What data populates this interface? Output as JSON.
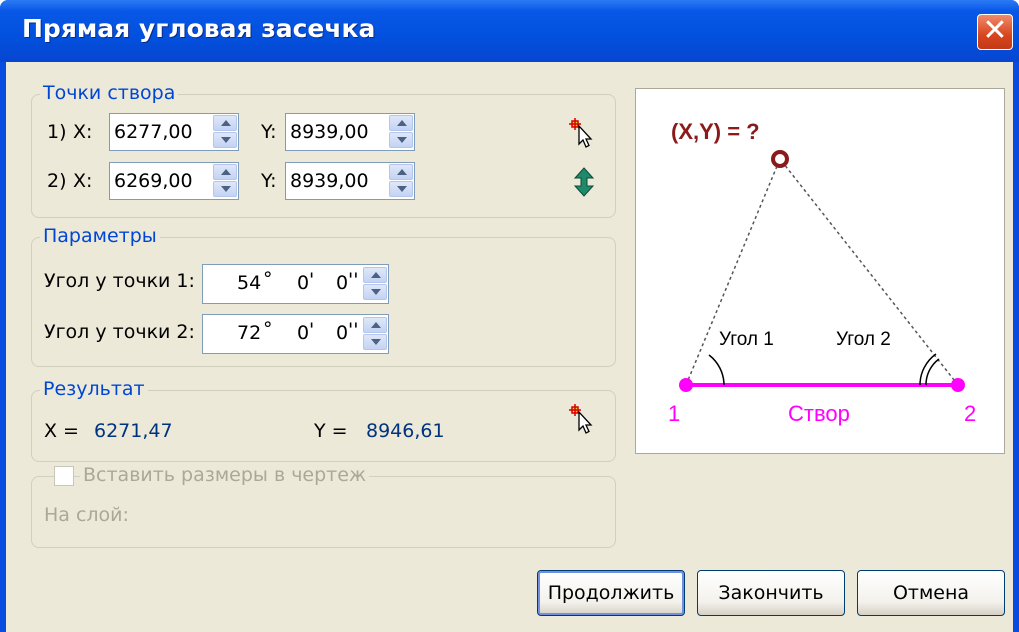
{
  "window": {
    "title": "Прямая угловая засечка",
    "close_symbol": "✕"
  },
  "points": {
    "legend": "Точки створа",
    "p1": {
      "prefix": "1)",
      "x_label": "X:",
      "x_value": "6277,00",
      "y_label": "Y:",
      "y_value": "8939,00"
    },
    "p2": {
      "prefix": "2)",
      "x_label": "X:",
      "x_value": "6269,00",
      "y_label": "Y:",
      "y_value": "8939,00"
    }
  },
  "params": {
    "legend": "Параметры",
    "angle1": {
      "label": "Угол у точки 1:",
      "deg": "54",
      "deg_sym": "°",
      "min": "0",
      "min_sym": "'",
      "sec": "0",
      "sec_sym": "''"
    },
    "angle2": {
      "label": "Угол у точки 2:",
      "deg": "72",
      "deg_sym": "°",
      "min": "0",
      "min_sym": "'",
      "sec": "0",
      "sec_sym": "''"
    }
  },
  "result": {
    "legend": "Результат",
    "x_label": "X =",
    "x_value": "6271,47",
    "y_label": "Y =",
    "y_value": "8946,61"
  },
  "insert": {
    "checkbox_label": "Вставить размеры в чертеж",
    "checked": false,
    "layer_label": "На слой:"
  },
  "diagram": {
    "question": "(X,Y) = ?",
    "angle1_label": "Угол 1",
    "angle2_label": "Угол 2",
    "point1_label": "1",
    "point2_label": "2",
    "baseline_label": "Створ",
    "colors": {
      "accent": "#ff00ff",
      "question": "#8b1a1a"
    }
  },
  "buttons": {
    "continue": "Продолжить",
    "finish": "Закончить",
    "cancel": "Отмена"
  },
  "colors": {
    "titlebar": "#0a4be0",
    "dialog_bg": "#ece9d8",
    "group_legend": "#0046d5"
  }
}
